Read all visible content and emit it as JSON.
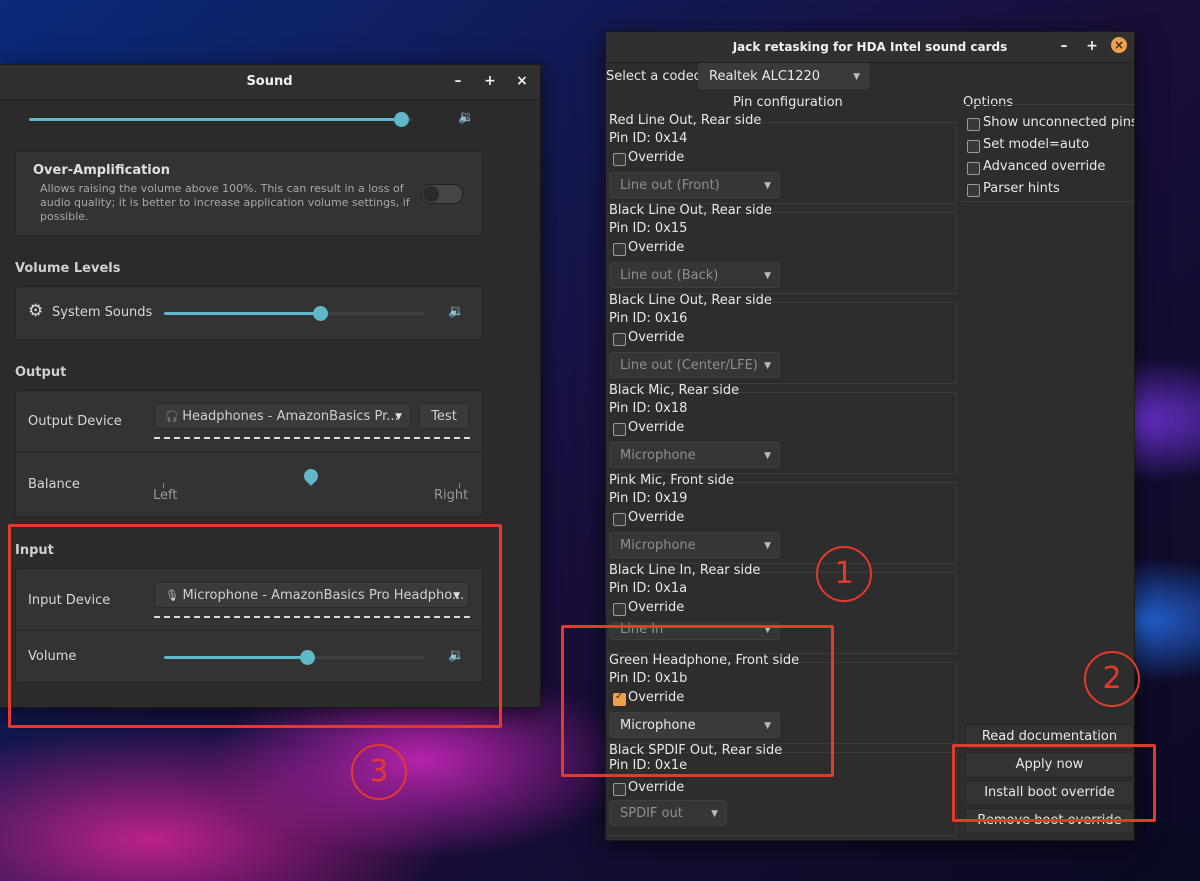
{
  "sound": {
    "title": "Sound",
    "over_amp": {
      "title": "Over-Amplification",
      "desc1": "Allows raising the volume above 100%. This can result in a loss of",
      "desc2": "audio quality; it is better to increase application volume settings, if",
      "desc3": "possible."
    },
    "volume_levels_heading": "Volume Levels",
    "system_sounds_label": "System Sounds",
    "output_heading": "Output",
    "output_device_label": "Output Device",
    "output_device_value": "Headphones - AmazonBasics Pr...",
    "test_label": "Test",
    "balance_label": "Balance",
    "balance_left": "Left",
    "balance_right": "Right",
    "input_heading": "Input",
    "input_device_label": "Input Device",
    "input_device_value": "Microphone - AmazonBasics Pro Headpho...",
    "volume_label": "Volume",
    "master_volume": 0.97,
    "system_sounds_level": 0.6,
    "balance_level": 0.5,
    "input_volume_level": 0.55
  },
  "jack": {
    "title": "Jack retasking for HDA Intel sound cards",
    "codec_label": "Select a codec:",
    "codec_value": "Realtek ALC1220",
    "pin_config_heading": "Pin configuration",
    "options_heading": "Options",
    "options": [
      "Show unconnected pins",
      "Set model=auto",
      "Advanced override",
      "Parser hints"
    ],
    "override_label": "Override",
    "pins": [
      {
        "name": "Red Line Out, Rear side",
        "id": "Pin ID: 0x14",
        "value": "Line out (Front)",
        "checked": false
      },
      {
        "name": "Black Line Out, Rear side",
        "id": "Pin ID: 0x15",
        "value": "Line out (Back)",
        "checked": false
      },
      {
        "name": "Black Line Out, Rear side",
        "id": "Pin ID: 0x16",
        "value": "Line out (Center/LFE)",
        "checked": false
      },
      {
        "name": "Black Mic, Rear side",
        "id": "Pin ID: 0x18",
        "value": "Microphone",
        "checked": false
      },
      {
        "name": "Pink Mic, Front side",
        "id": "Pin ID: 0x19",
        "value": "Microphone",
        "checked": false
      },
      {
        "name": "Black Line In, Rear side",
        "id": "Pin ID: 0x1a",
        "value": "Line In",
        "checked": false
      },
      {
        "name": "Green Headphone, Front side",
        "id": "Pin ID: 0x1b",
        "value": "Microphone",
        "checked": true
      },
      {
        "name": "Black SPDIF Out, Rear side",
        "id": "Pin ID: 0x1e",
        "value": "SPDIF out",
        "checked": false
      }
    ],
    "buttons": {
      "read_doc": "Read documentation",
      "apply_now": "Apply now",
      "install_boot": "Install boot override",
      "remove_boot": "Remove boot override"
    }
  },
  "annotations": [
    "1",
    "2",
    "3"
  ],
  "colors": {
    "accent": "#5fb7c8",
    "highlight": "#e4392b",
    "checkbox": "#f0a04b"
  }
}
